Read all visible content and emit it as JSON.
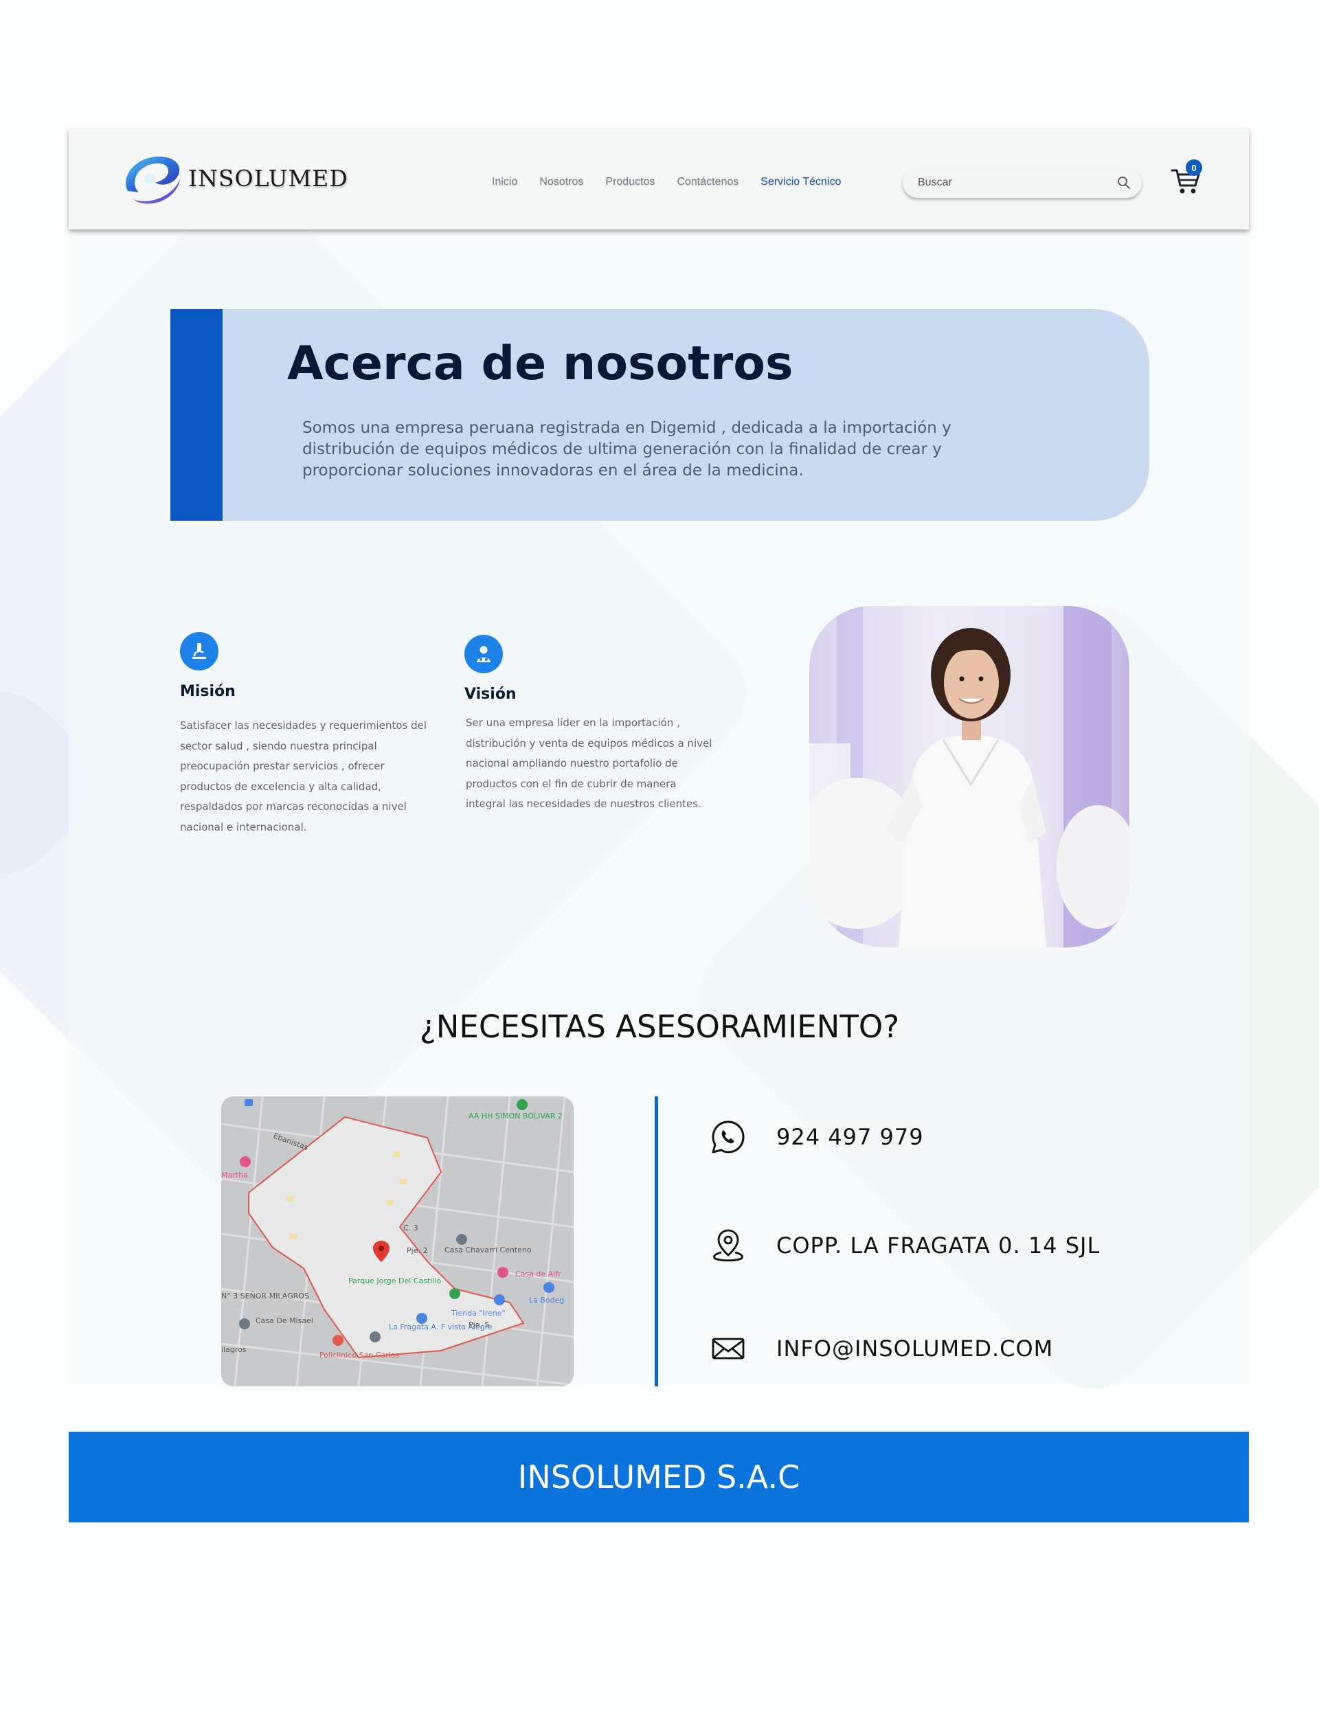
{
  "brand": {
    "name": "INSOLUMED"
  },
  "nav": {
    "items": [
      "Inicio",
      "Nosotros",
      "Productos",
      "Contáctenos",
      "Servicio Técnico"
    ],
    "active": "Servicio Técnico"
  },
  "search": {
    "placeholder": "Buscar",
    "value": ""
  },
  "cart": {
    "count": "0"
  },
  "about": {
    "title": "Acerca de nosotros",
    "text": "Somos una empresa peruana registrada en Digemid , dedicada a la importación y distribución de equipos médicos de ultima generación con la finalidad de crear y proporcionar soluciones innovadoras en el área de la medicina."
  },
  "mission": {
    "title": "Misión",
    "text": "Satisfacer las necesidades y requerimientos del sector salud , siendo nuestra principal preocupación prestar servicios , ofrecer productos de excelencia y alta calidad, respaldados por marcas reconocidas a nivel nacional e internacional."
  },
  "vision": {
    "title": "Visión",
    "text": "Ser una empresa líder en la importación , distribución y venta de equipos médicos a nivel nacional ampliando nuestro portafolio de productos con el fin de cubrir de manera integral las necesidades de nuestros clientes."
  },
  "contact": {
    "heading": "¿NECESITAS ASESORAMIENTO?",
    "phone": "924 497 979",
    "address": "COPP. LA FRAGATA 0. 14 SJL",
    "email": "INFO@INSOLUMED.COM"
  },
  "map": {
    "labels": [
      "AA HH SIMON BOLIVAR 2",
      "Martha",
      "Casa Chavarri Centeno",
      "Casa de Alfr",
      "Parque Jorge Del Castillo",
      "N° 3 SEÑOR MILAGROS",
      "La Bodeg",
      "Casa De Misael",
      "Tienda \"Irene\"",
      "La Fragata A. F vista Alegre",
      "Policlinico San Carlos",
      "ilagros",
      "Ebanistas",
      "Pje. 2",
      "Pje. 5",
      "C. 3"
    ]
  },
  "footer": {
    "text": "INSOLUMED S.A.C"
  },
  "colors": {
    "primary": "#0a59c2",
    "accent": "#1d83e8",
    "footer": "#0a73dc",
    "about_bg": "#c4d6f0"
  }
}
